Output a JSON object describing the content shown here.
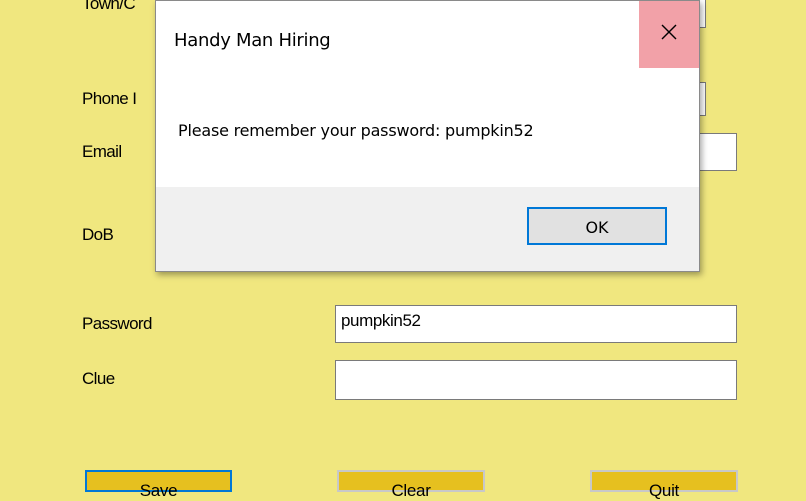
{
  "form": {
    "labels": {
      "town": "Town/C",
      "phone": "Phone I",
      "email": "Email",
      "dob": "DoB",
      "password": "Password",
      "clue": "Clue"
    },
    "fields": {
      "password_value": "pumpkin52",
      "clue_value": ""
    },
    "buttons": {
      "save": "Save",
      "clear": "Clear",
      "quit": "Quit"
    }
  },
  "dialog": {
    "title": "Handy Man Hiring",
    "message": "Please remember your password: pumpkin52",
    "ok_label": "OK",
    "close_icon": "close-icon"
  },
  "colors": {
    "form_background": "#f0e77f",
    "button_background": "#e6c01f",
    "close_hover": "#f2a1a8",
    "focus_border": "#0078d7"
  }
}
